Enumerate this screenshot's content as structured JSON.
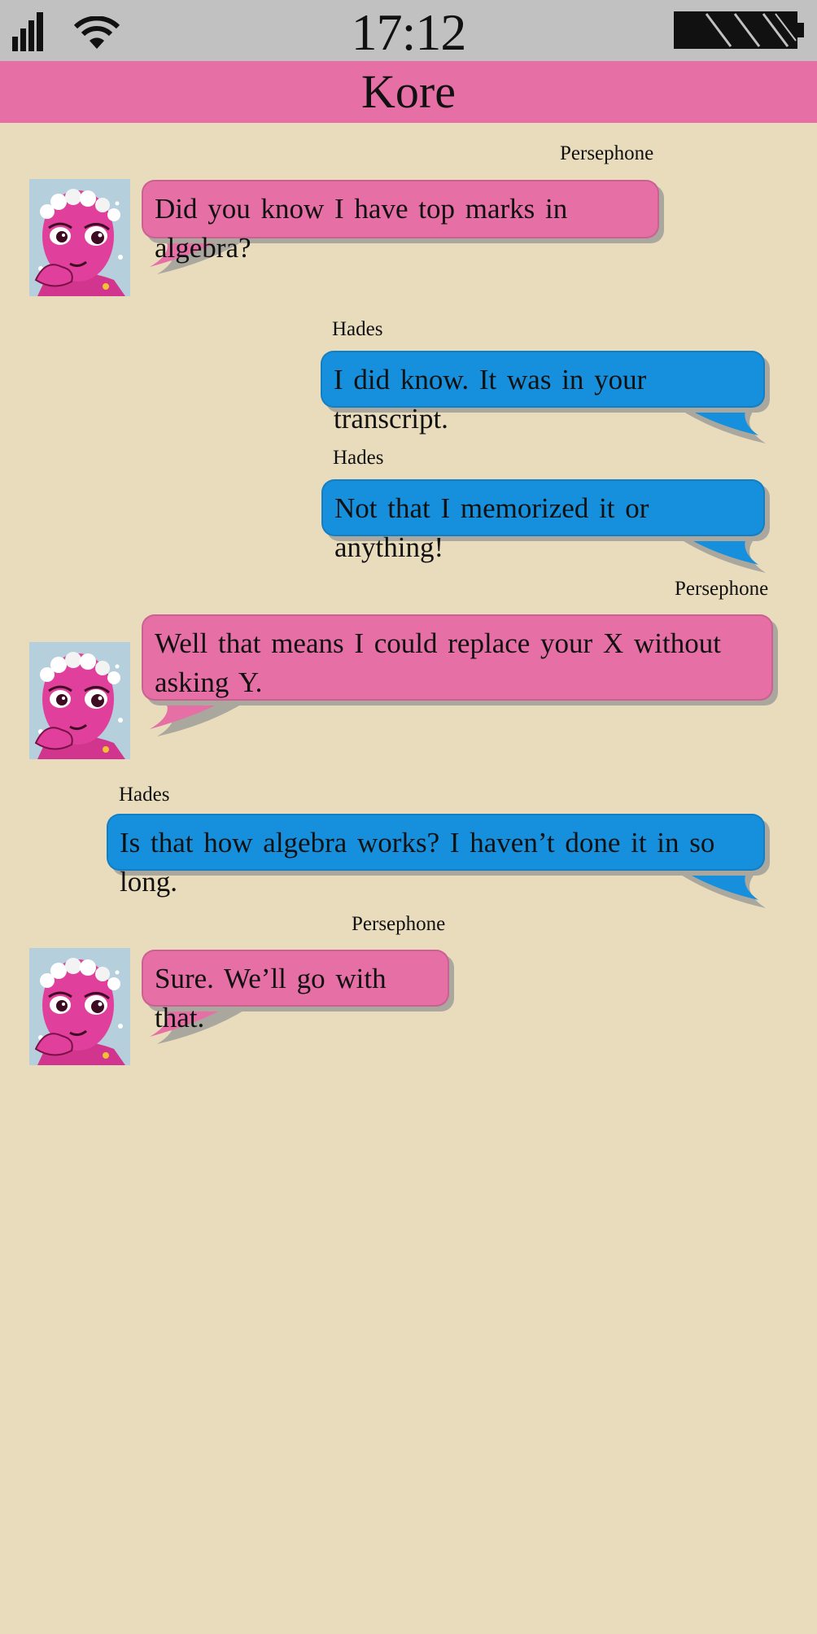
{
  "status_bar": {
    "time": "17:12",
    "signal_icon": "signal-bars-icon",
    "wifi_icon": "wifi-icon",
    "battery_icon": "battery-icon"
  },
  "header": {
    "title": "Kore"
  },
  "messages": [
    {
      "sender": "Persephone",
      "text": "Did you know I have top marks in algebra?",
      "side": "left",
      "color": "#e66fa5"
    },
    {
      "sender": "Hades",
      "text": "I did know. It was in your transcript.",
      "side": "right",
      "color": "#1690dc"
    },
    {
      "sender": "Hades",
      "text": "Not that I memorized it or anything!",
      "side": "right",
      "color": "#1690dc"
    },
    {
      "sender": "Persephone",
      "text": "Well that means I could replace your X without asking Y.",
      "side": "left",
      "color": "#e66fa5"
    },
    {
      "sender": "Hades",
      "text": "Is that how algebra works? I haven’t done it in so long.",
      "side": "right",
      "color": "#1690dc"
    },
    {
      "sender": "Persephone",
      "text": "Sure. We’ll go with that.",
      "side": "left",
      "color": "#e66fa5"
    }
  ],
  "colors": {
    "background": "#e9dcbc",
    "status_bar": "#c1c1c1",
    "title_bar": "#e66fa5",
    "persephone_bubble": "#e66fa5",
    "hades_bubble": "#1690dc"
  }
}
